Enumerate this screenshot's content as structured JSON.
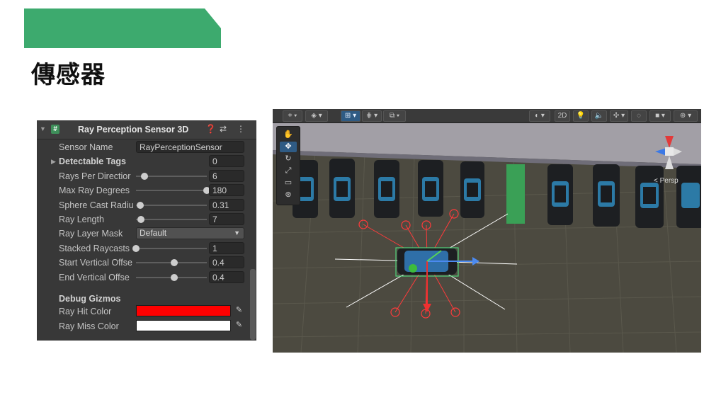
{
  "slide": {
    "title": "傳感器"
  },
  "inspector": {
    "component_title": "Ray Perception Sensor 3D",
    "header_icons": [
      "help-icon",
      "preset-icon",
      "kebab-menu-icon"
    ],
    "rows": {
      "sensor_name": {
        "label": "Sensor Name",
        "value": "RayPerceptionSensor"
      },
      "detectable_tags": {
        "label": "Detectable Tags",
        "value": "0"
      },
      "rays_per_direction": {
        "label": "Rays Per Directior",
        "value": "6",
        "slider": 0.12
      },
      "max_ray_degrees": {
        "label": "Max Ray Degrees",
        "value": "180",
        "slider": 1.0
      },
      "sphere_cast_radius": {
        "label": "Sphere Cast Radiu",
        "value": "0.31",
        "slider": 0.06
      },
      "ray_length": {
        "label": "Ray Length",
        "value": "7",
        "slider": 0.07
      },
      "ray_layer_mask": {
        "label": "Ray Layer Mask",
        "value": "Default"
      },
      "stacked_raycasts": {
        "label": "Stacked Raycasts",
        "value": "1",
        "slider": 0.0
      },
      "start_vertical_offset": {
        "label": "Start Vertical Offse",
        "value": "0.4",
        "slider": 0.54
      },
      "end_vertical_offset": {
        "label": "End Vertical Offse",
        "value": "0.4",
        "slider": 0.54
      }
    },
    "debug": {
      "section_label": "Debug Gizmos",
      "ray_hit_color": {
        "label": "Ray Hit Color",
        "color": "#ff0000"
      },
      "ray_miss_color": {
        "label": "Ray Miss Color",
        "color": "#ffffff"
      }
    }
  },
  "scene": {
    "toolbar": {
      "mode_2d": "2D"
    },
    "persp_label": "< Persp",
    "colors": {
      "ray_hit": "#ff3b3b",
      "ray_miss": "#ffffff",
      "ground": "#4c4a40",
      "wall": "#9e9aa4",
      "goal": "#3aa056",
      "agent": "#2f6fa8"
    }
  }
}
